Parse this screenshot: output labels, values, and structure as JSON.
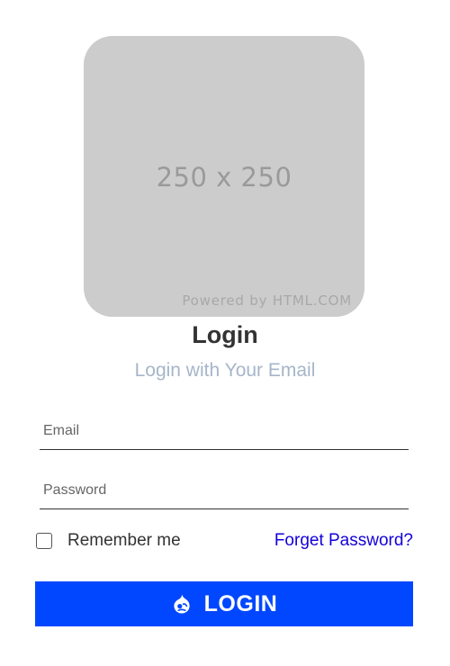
{
  "placeholder_image": {
    "size_text": "250 x 250",
    "credit_text": "Powered by HTML.COM"
  },
  "header": {
    "title": "Login",
    "subtitle": "Login with Your Email"
  },
  "form": {
    "email_placeholder": "Email",
    "email_value": "",
    "password_placeholder": "Password",
    "password_value": "",
    "remember_label": "Remember me",
    "remember_checked": false,
    "forgot_label": "Forget Password?",
    "submit_label": "LOGIN",
    "submit_icon": "drupal-icon"
  },
  "colors": {
    "button_bg": "#0047ff",
    "link": "#1400d9",
    "subtitle": "#a6b5c9",
    "placeholder_bg": "#cccccc"
  }
}
